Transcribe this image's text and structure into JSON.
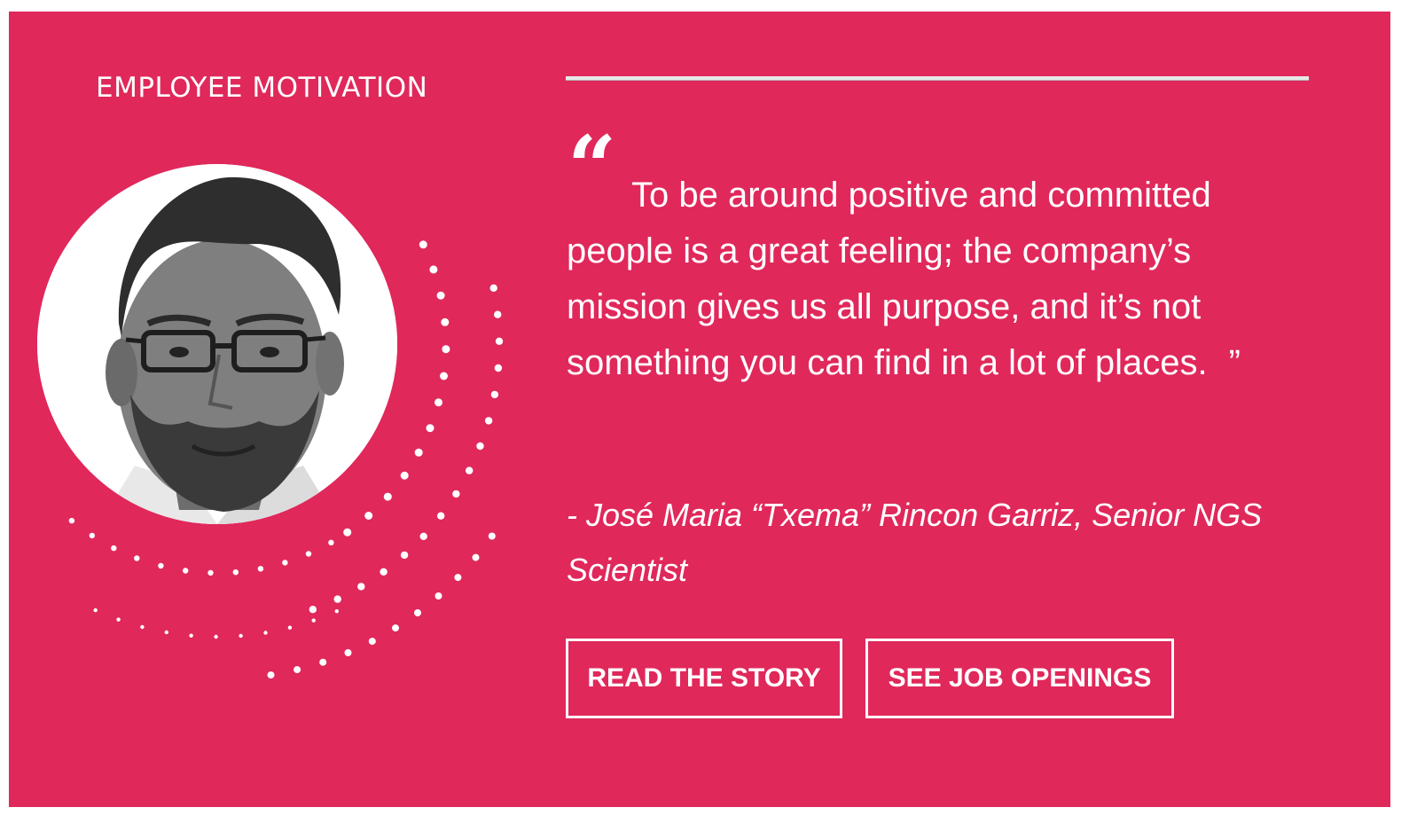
{
  "section": {
    "label": "EMPLOYEE MOTIVATION"
  },
  "quote": {
    "open_mark": "“",
    "text": "To be around positive and committed people is a great feeling; the company’s mission gives us all purpose, and it’s not something you can find in a lot of places.",
    "close_mark": "”",
    "attribution": "- José Maria “Txema” Rincon Garriz, Senior NGS Scientist"
  },
  "buttons": {
    "read_story": "READ THE STORY",
    "job_openings": "SEE JOB OPENINGS"
  },
  "colors": {
    "background": "#e0285b",
    "text": "#ffffff"
  },
  "icons": {
    "portrait": "employee-portrait",
    "decoration": "dotted-arcs"
  }
}
